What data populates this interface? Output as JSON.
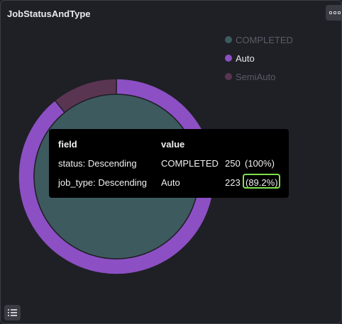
{
  "panel": {
    "title": "JobStatusAndType",
    "menu_icon": "panel-menu-icon",
    "list_icon": "list-icon"
  },
  "legend": {
    "items": [
      {
        "label": "COMPLETED",
        "color": "#3d5a5f",
        "muted": true
      },
      {
        "label": "Auto",
        "color": "#8d4fc4",
        "muted": false
      },
      {
        "label": "SemiAuto",
        "color": "#5a3552",
        "muted": true
      }
    ]
  },
  "tooltip": {
    "header_field": "field",
    "header_value": "value",
    "rows": [
      {
        "field": "status: Descending",
        "value": "COMPLETED",
        "count": "250",
        "pct": "(100%)"
      },
      {
        "field": " job_type: Descending",
        "value": "Auto",
        "count": "223",
        "pct": "(89.2%)"
      }
    ]
  },
  "chart_data": {
    "type": "pie",
    "inner_ring": {
      "field": "status",
      "slices": [
        {
          "name": "COMPLETED",
          "value": 250,
          "color": "#3d5a5f"
        }
      ]
    },
    "outer_ring": {
      "field": "job_type",
      "slices": [
        {
          "name": "Auto",
          "value": 223,
          "color": "#8d4fc4"
        },
        {
          "name": "SemiAuto",
          "value": 27,
          "color": "#5a3552"
        }
      ]
    }
  }
}
